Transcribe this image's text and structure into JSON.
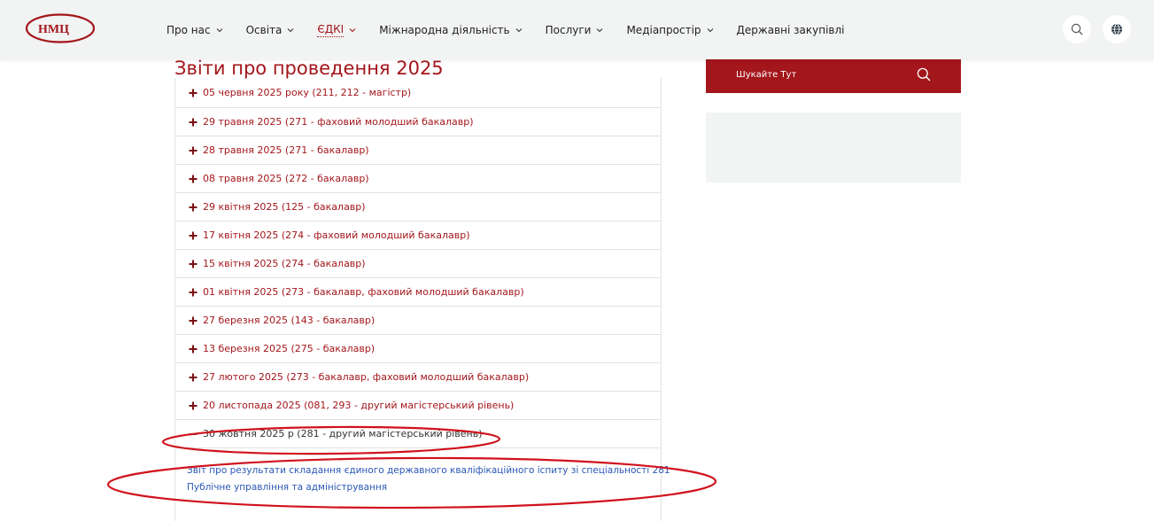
{
  "header": {
    "logo_text": "НМЦ",
    "nav": [
      {
        "label": "Про нас",
        "has_dropdown": true,
        "active": false
      },
      {
        "label": "Освіта",
        "has_dropdown": true,
        "active": false
      },
      {
        "label": "ЄДКІ",
        "has_dropdown": true,
        "active": true
      },
      {
        "label": "Міжнародна діяльність",
        "has_dropdown": true,
        "active": false
      },
      {
        "label": "Послуги",
        "has_dropdown": true,
        "active": false
      },
      {
        "label": "Медіапростір",
        "has_dropdown": true,
        "active": false
      },
      {
        "label": "Державні закупівлі",
        "has_dropdown": false,
        "active": false
      }
    ],
    "icons": [
      "search-icon",
      "globe-icon"
    ]
  },
  "main": {
    "title": "Звіти про проведення 2025",
    "accordion": [
      {
        "label": "05 червня 2025 року (211, 212 - магістр)",
        "open": false
      },
      {
        "label": "29 травня 2025 (271 - фаховий молодший бакалавр)",
        "open": false
      },
      {
        "label": "28 травня 2025 (271 - бакалавр)",
        "open": false
      },
      {
        "label": "08 травня 2025 (272 - бакалавр)",
        "open": false
      },
      {
        "label": "29 квітня 2025 (125 - бакалавр)",
        "open": false
      },
      {
        "label": "17 квітня 2025 (274 - фаховий молодший бакалавр)",
        "open": false
      },
      {
        "label": "15 квітня 2025 (274 - бакалавр)",
        "open": false
      },
      {
        "label": "01 квітня 2025 (273 - бакалавр, фаховий молодший бакалавр)",
        "open": false
      },
      {
        "label": "27 березня 2025 (143 - бакалавр)",
        "open": false
      },
      {
        "label": "13 березня 2025 (275 - бакалавр)",
        "open": false
      },
      {
        "label": "27 лютого 2025 (273 - бакалавр, фаховий молодший бакалавр)",
        "open": false
      },
      {
        "label": "20 листопада 2025 (081, 293 - другий магістерський рівень)",
        "open": false
      },
      {
        "label": "30 жовтня 2025 р (281 - другий магістерський рівень)",
        "open": true
      }
    ],
    "open_content": {
      "link_line1": "Звіт про результати складання єдиного державного кваліфікаційного іспиту зі спеціальності 281",
      "link_line2": "Публічне управління та адміністрування"
    }
  },
  "sidebar": {
    "search_placeholder": "Шукайте Тут"
  },
  "colors": {
    "brand_red": "#a3161b",
    "link_blue": "#2a57b5",
    "header_bg": "#f2f3f3",
    "annotation_red": "#d0121d"
  }
}
